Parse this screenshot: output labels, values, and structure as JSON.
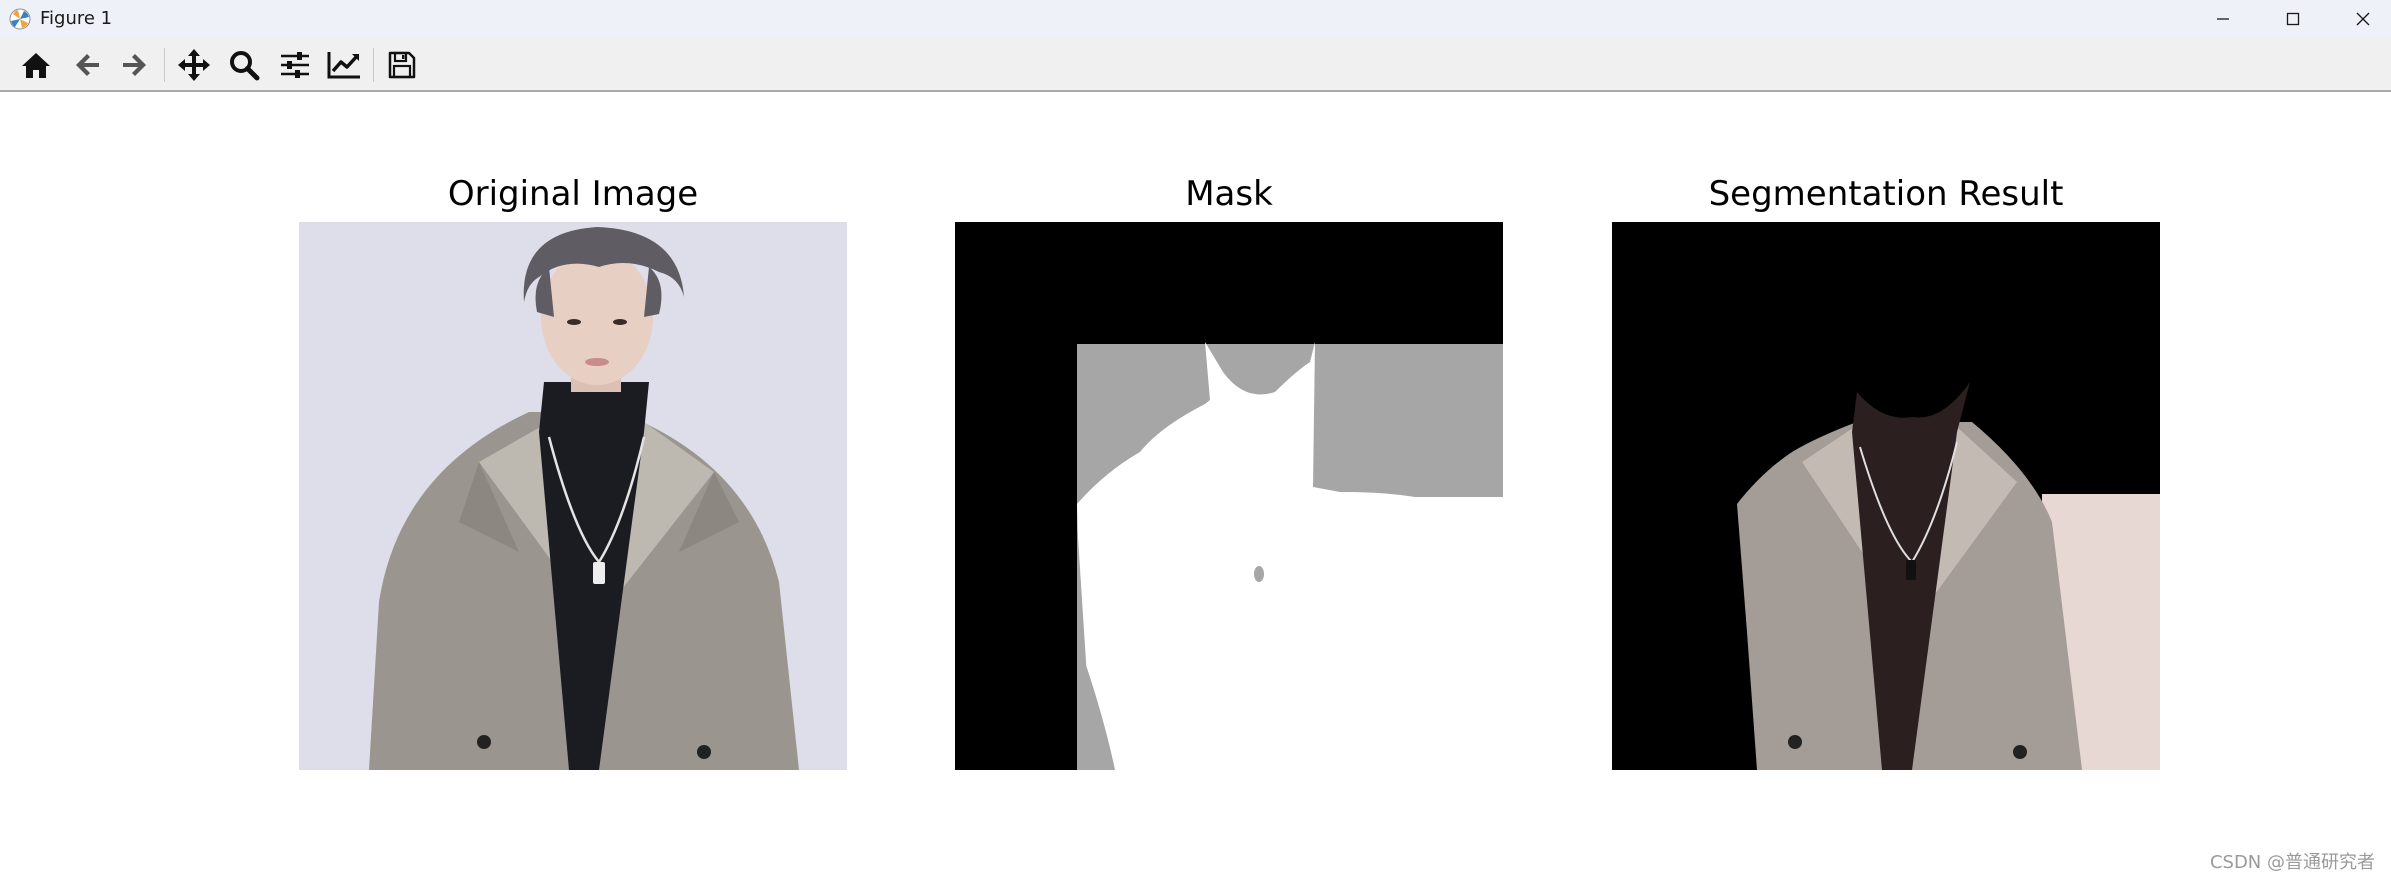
{
  "window": {
    "title": "Figure 1",
    "app_icon": "matplotlib-icon"
  },
  "toolbar": {
    "items": [
      {
        "name": "home",
        "icon": "home-icon"
      },
      {
        "name": "back",
        "icon": "arrow-left-icon"
      },
      {
        "name": "forward",
        "icon": "arrow-right-icon"
      },
      {
        "name": "pan",
        "icon": "move-icon"
      },
      {
        "name": "zoom",
        "icon": "zoom-icon"
      },
      {
        "name": "subplots",
        "icon": "sliders-icon"
      },
      {
        "name": "customize",
        "icon": "chart-line-icon"
      },
      {
        "name": "save",
        "icon": "save-icon"
      }
    ]
  },
  "figure": {
    "panels": [
      {
        "title": "Original Image"
      },
      {
        "title": "Mask"
      },
      {
        "title": "Segmentation Result"
      }
    ]
  },
  "watermark": "CSDN @普通研究者",
  "colors": {
    "titlebar_bg": "#eef1f8",
    "toolbar_bg": "#f0f0f0",
    "mask_gray": "#a6a6a6",
    "photo_bg": "#d9d8e6",
    "coat": "#9a968f"
  }
}
